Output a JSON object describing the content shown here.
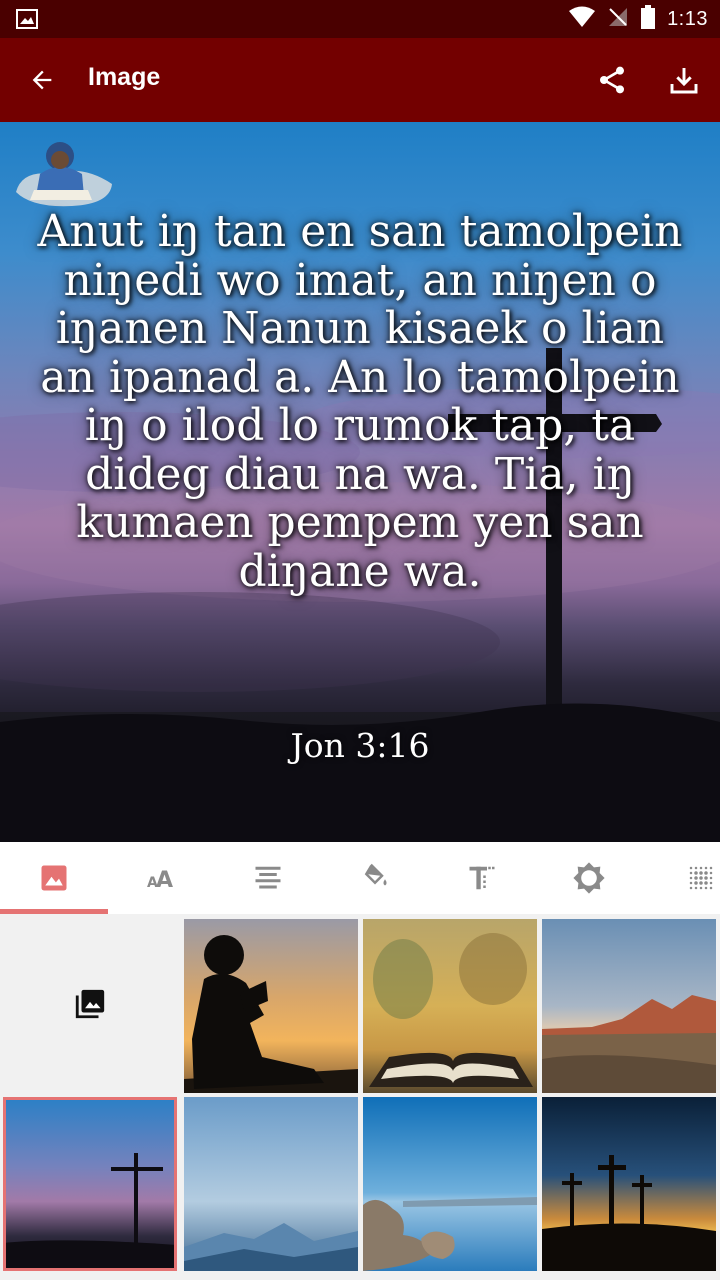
{
  "status_bar": {
    "time": "1:13",
    "icons": [
      "image-notification-icon",
      "wifi-icon",
      "no-signal-icon",
      "battery-icon"
    ]
  },
  "app_bar": {
    "title": "Image",
    "back_icon": "arrow-left-icon",
    "actions": [
      "share-icon",
      "download-icon"
    ],
    "color": "#730000"
  },
  "verse_card": {
    "text": "Anut iŋ tan en san tamolpein niŋedi wo imat, an niŋen o iŋanen Nanun kisaek o lian an ipanad a. An lo tamolpein iŋ o ilod lo rumok tap, ta dideg diau na wa. Tia, iŋ kumaen pempem yen san diŋane wa.",
    "reference": "Jon 3:16"
  },
  "tabs": [
    {
      "icon": "image-icon",
      "active": true
    },
    {
      "icon": "font-size-icon",
      "active": false
    },
    {
      "icon": "align-center-icon",
      "active": false
    },
    {
      "icon": "paint-bucket-icon",
      "active": false
    },
    {
      "icon": "text-style-icon",
      "active": false
    },
    {
      "icon": "brightness-icon",
      "active": false
    },
    {
      "icon": "texture-icon",
      "active": false
    }
  ],
  "accent_color": "#e57373",
  "gallery": {
    "open_gallery_icon": "photo-library-icon",
    "thumbnails": [
      {
        "name": "boy-reading-sunset",
        "selected": false
      },
      {
        "name": "open-bible-bokeh",
        "selected": false
      },
      {
        "name": "desert-mountains",
        "selected": false
      },
      {
        "name": "cross-sunset",
        "selected": true
      },
      {
        "name": "misty-mountains",
        "selected": false
      },
      {
        "name": "rocky-lake",
        "selected": false
      },
      {
        "name": "three-crosses",
        "selected": false
      }
    ]
  }
}
